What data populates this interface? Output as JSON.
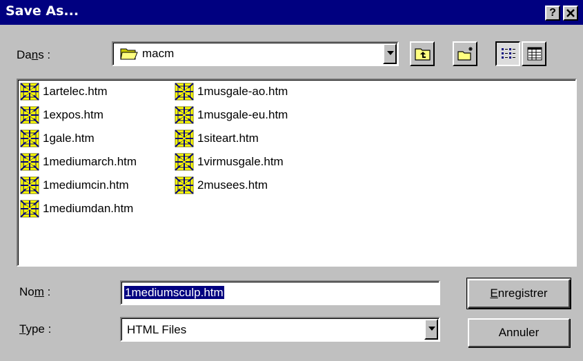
{
  "window": {
    "title": "Save As...",
    "help_label": "?",
    "close_label": "✕"
  },
  "location": {
    "label_pre": "Da",
    "label_ul": "n",
    "label_post": "s :",
    "current_folder": "macm"
  },
  "files": [
    {
      "name": "1artelec.htm"
    },
    {
      "name": "1expos.htm"
    },
    {
      "name": "1gale.htm"
    },
    {
      "name": "1mediumarch.htm"
    },
    {
      "name": "1mediumcin.htm"
    },
    {
      "name": "1mediumdan.htm"
    },
    {
      "name": "1musgale-ao.htm"
    },
    {
      "name": "1musgale-eu.htm"
    },
    {
      "name": "1siteart.htm"
    },
    {
      "name": "1virmusgale.htm"
    },
    {
      "name": "2musees.htm"
    }
  ],
  "filename": {
    "label_pre": "No",
    "label_ul": "m",
    "label_post": " :",
    "value": "1mediumsculp.htm"
  },
  "filetype": {
    "label_ul": "T",
    "label_post": "ype :",
    "value": "HTML Files"
  },
  "buttons": {
    "save_ul": "E",
    "save_rest": "nregistrer",
    "cancel": "Annuler"
  }
}
